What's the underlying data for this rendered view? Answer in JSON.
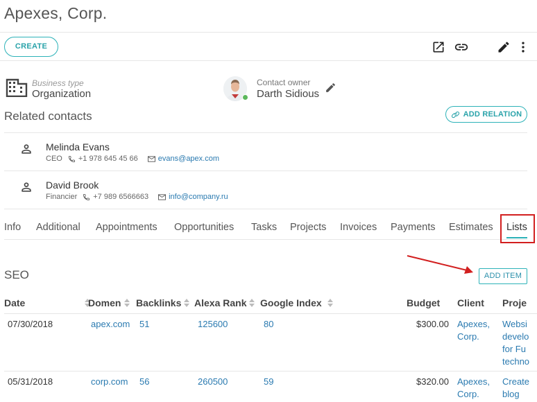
{
  "header": {
    "title": "Apexes, Corp."
  },
  "toolbar": {
    "create_label": "CREATE",
    "icons": [
      "open-external-icon",
      "link-icon",
      "edit-icon",
      "more-vert-icon"
    ]
  },
  "details": {
    "business_type_label": "Business type",
    "business_type_value": "Organization",
    "contact_owner_label": "Contact owner",
    "contact_owner_value": "Darth Sidious",
    "owner_status_color": "#5cb85c"
  },
  "related": {
    "title": "Related contacts",
    "add_relation_label": "ADD RELATION",
    "contacts": [
      {
        "name": "Melinda Evans",
        "role": "CEO",
        "phone": "+1 978 645 45 66",
        "email": "evans@apex.com"
      },
      {
        "name": "David Brook",
        "role": "Financier",
        "phone": "+7 989 6566663",
        "email": "info@company.ru"
      }
    ]
  },
  "tabs": [
    "Info",
    "Additional",
    "Appointments",
    "Opportunities",
    "Tasks",
    "Projects",
    "Invoices",
    "Payments",
    "Estimates",
    "Lists"
  ],
  "active_tab": "Lists",
  "list": {
    "title": "SEO",
    "add_item_label": "ADD ITEM",
    "columns": [
      "Date",
      "Domen",
      "Backlinks",
      "Alexa Rank",
      "Google Index",
      "Budget",
      "Client",
      "Proje"
    ],
    "rows": [
      {
        "date": "07/30/2018",
        "domain": "apex.com",
        "backlinks": "51",
        "alexa": "125600",
        "google": "80",
        "budget": "$300.00",
        "client": [
          "Apexes,",
          "Corp."
        ],
        "project": [
          "Websi",
          "develo",
          "for Fu",
          "techno"
        ]
      },
      {
        "date": "05/31/2018",
        "domain": "corp.com",
        "backlinks": "56",
        "alexa": "260500",
        "google": "59",
        "budget": "$320.00",
        "client": [
          "Apexes,",
          "Corp."
        ],
        "project": [
          "Create",
          "blog"
        ]
      }
    ]
  },
  "colors": {
    "accent": "#2cb2b8",
    "link": "#2a7ab0",
    "annotation": "#d21f1f"
  }
}
